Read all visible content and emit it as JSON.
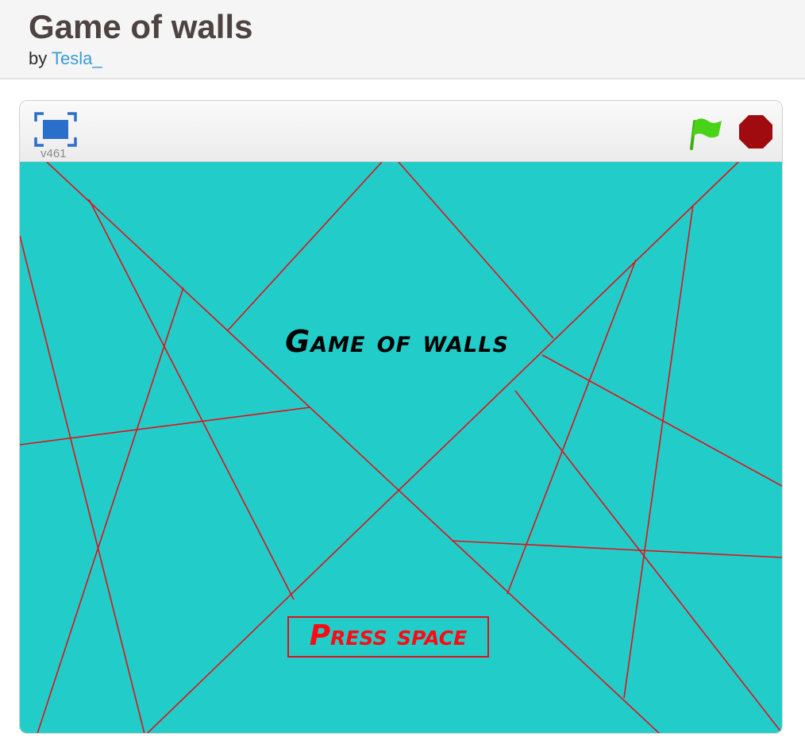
{
  "header": {
    "title": "Game of walls",
    "by_label": "by",
    "author": "Tesla_"
  },
  "player": {
    "version": "v461",
    "icons": {
      "fullscreen": "fullscreen-icon",
      "green_flag": "green-flag-icon",
      "stop": "stop-icon"
    },
    "colors": {
      "fullscreen": "#2a6fc9",
      "green_flag": "#4ad218",
      "stop": "#a00b10"
    }
  },
  "stage": {
    "background_color": "#22cdc9",
    "wall_color": "#e0101a",
    "title_text": "Game of walls",
    "prompt_text": "Press space"
  }
}
